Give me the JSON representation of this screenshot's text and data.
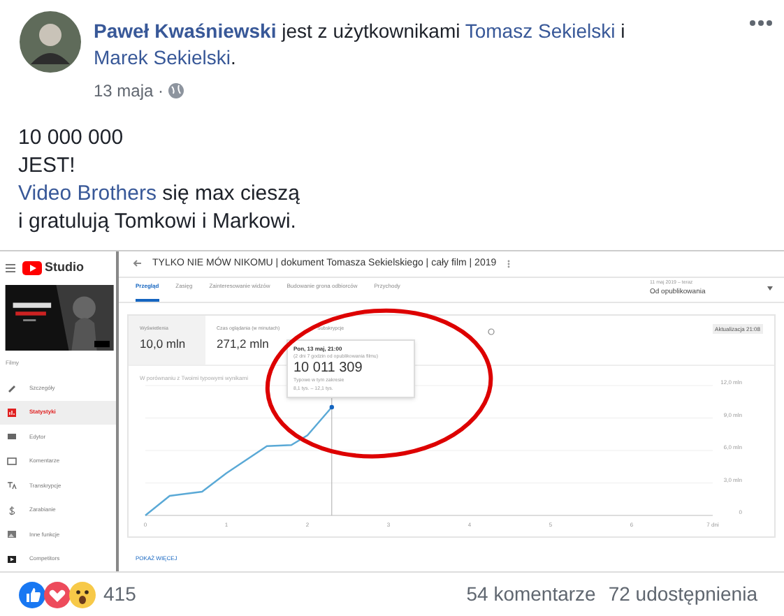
{
  "post": {
    "author": "Paweł Kwaśniewski",
    "with_text": "jest z użytkownikami",
    "tagged": [
      "Tomasz Sekielski",
      "Marek Sekielski"
    ],
    "conjunction": "i",
    "end": ".",
    "date": "13 maja ·",
    "message": [
      {
        "text": "10 000 000"
      },
      {
        "text": "JEST!"
      },
      {
        "link": "Video Brothers",
        "text": " się max cieszą"
      },
      {
        "text": "i gratulują Tomkowi i Markowi."
      }
    ]
  },
  "studio": {
    "logo": "Studio",
    "title": "TYLKO NIE MÓW NIKOMU | dokument Tomasza Sekielskiego | cały film | 2019",
    "sidebar_heading": "Filmy",
    "sidebar": [
      {
        "label": "Szczegóły",
        "selected": false
      },
      {
        "label": "Statystyki",
        "selected": true
      },
      {
        "label": "Edytor",
        "selected": false
      },
      {
        "label": "Komentarze",
        "selected": false
      },
      {
        "label": "Transkrypcje",
        "selected": false
      },
      {
        "label": "Zarabianie",
        "selected": false
      },
      {
        "label": "Inne funkcje",
        "selected": false
      },
      {
        "label": "Competitors",
        "selected": false
      }
    ],
    "tabs": [
      {
        "label": "Przegląd",
        "selected": true
      },
      {
        "label": "Zasięg",
        "selected": false
      },
      {
        "label": "Zainteresowanie widzów",
        "selected": false
      },
      {
        "label": "Budowanie grona odbiorców",
        "selected": false
      },
      {
        "label": "Przychody",
        "selected": false
      }
    ],
    "date_range": "11 maj 2019 – teraz",
    "date_option": "Od opublikowania",
    "metrics": [
      {
        "label": "Wyświetlenia",
        "value": "10,0 mln",
        "selected": true
      },
      {
        "label": "Czas oglądania (w minutach)",
        "value": "271,2 mln",
        "selected": false
      },
      {
        "label": "Subskrypcje",
        "selected": false
      }
    ],
    "updated": "Aktualizacja 21:08",
    "comparison": "W porównaniu z Twoimi typowymi wynikami",
    "tooltip": {
      "date": "Pon, 13 maj, 21:00",
      "note": "(2 dni 7 godzin od opublikowania filmu)",
      "value": "10 011 309",
      "typical_label": "Typowe w tym zakresie",
      "typical_range": "8,1 tys. – 12,1 tys."
    },
    "chart_data": {
      "type": "line",
      "x": [
        0,
        0.3,
        0.7,
        1,
        1.5,
        1.8,
        2,
        2.3
      ],
      "series": [
        {
          "color": "#5aa9d6",
          "values": [
            0,
            1.8,
            2.2,
            3.9,
            6.4,
            6.5,
            7.4,
            10.0
          ]
        }
      ],
      "xlim": [
        0,
        7
      ],
      "ylim": [
        0,
        12
      ],
      "grid": true,
      "ref_lines": [
        {
          "axis": "x",
          "value": 2.3
        }
      ],
      "xticks": [
        0,
        1,
        2,
        3,
        4,
        5,
        6,
        {
          "value": 7,
          "label": "7 dni"
        }
      ],
      "yticks": [
        {
          "value": 0,
          "label": "0"
        },
        {
          "value": 3,
          "label": "3,0 mln"
        },
        {
          "value": 6,
          "label": "6,0 mln"
        },
        {
          "value": 9,
          "label": "9,0 mln"
        },
        {
          "value": 12,
          "label": "12,0 mln"
        }
      ]
    },
    "show_more": "POKAŻ WIĘCEJ"
  },
  "footer": {
    "reaction_count": "415",
    "comments": "54 komentarze",
    "shares": "72 udostępnienia"
  }
}
